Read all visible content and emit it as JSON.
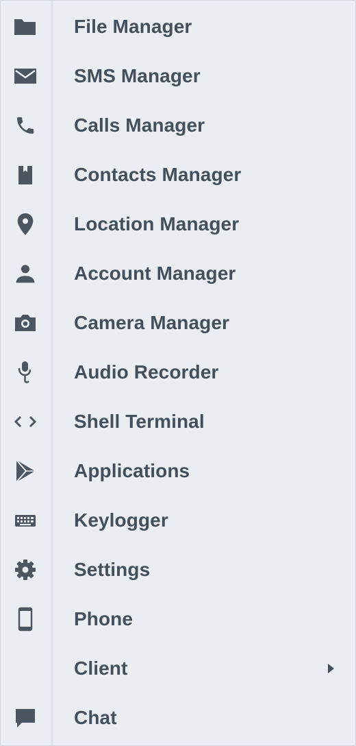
{
  "menu": {
    "items": [
      {
        "label": "File Manager",
        "icon": "folder-icon"
      },
      {
        "label": "SMS Manager",
        "icon": "envelope-icon"
      },
      {
        "label": "Calls Manager",
        "icon": "phone-call-icon"
      },
      {
        "label": "Contacts Manager",
        "icon": "contacts-book-icon"
      },
      {
        "label": "Location Manager",
        "icon": "map-pin-icon"
      },
      {
        "label": "Account Manager",
        "icon": "person-icon"
      },
      {
        "label": "Camera Manager",
        "icon": "camera-icon"
      },
      {
        "label": "Audio Recorder",
        "icon": "microphone-icon"
      },
      {
        "label": "Shell Terminal",
        "icon": "code-brackets-icon"
      },
      {
        "label": "Applications",
        "icon": "play-store-icon"
      },
      {
        "label": "Keylogger",
        "icon": "keyboard-icon"
      },
      {
        "label": "Settings",
        "icon": "gear-icon"
      },
      {
        "label": "Phone",
        "icon": "smartphone-icon"
      },
      {
        "label": "Client",
        "icon": "",
        "submenu_indicator": "chevron-right-icon"
      },
      {
        "label": "Chat",
        "icon": "chat-bubble-icon"
      }
    ]
  },
  "colors": {
    "background": "#eaeef2",
    "text": "#434f5a",
    "icon": "#4c5660",
    "divider": "#d7dde3"
  }
}
